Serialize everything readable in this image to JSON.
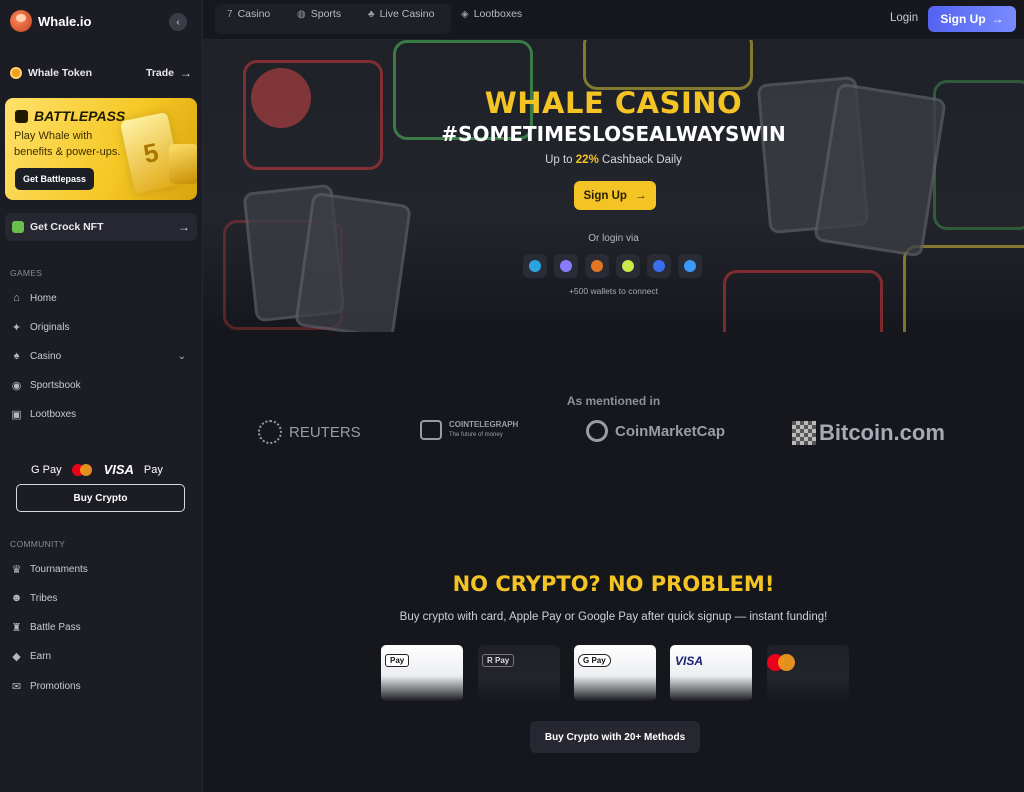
{
  "sidebar": {
    "brand": "Whale.io",
    "collapse_icon": "chevron-left-icon",
    "token": {
      "label": "Whale Token",
      "trade": "Trade"
    },
    "battlepass": {
      "title": "BATTLEPASS",
      "text": "Play Whale with benefits & power-ups.",
      "button": "Get Battlepass",
      "art_number": "5"
    },
    "crock": {
      "label": "Get Crock NFT"
    },
    "games_label": "GAMES",
    "games": [
      {
        "label": "Home",
        "icon": "home-icon"
      },
      {
        "label": "Originals",
        "icon": "originals-icon"
      },
      {
        "label": "Casino",
        "icon": "casino-icon"
      },
      {
        "label": "Sportsbook",
        "icon": "sportsbook-icon"
      },
      {
        "label": "Lootboxes",
        "icon": "lootbox-icon"
      }
    ],
    "payments": {
      "gpay": "G Pay",
      "visa": "VISA",
      "apay": " Pay"
    },
    "buy_crypto": "Buy Crypto",
    "community_label": "COMMUNITY",
    "community": [
      {
        "label": "Tournaments",
        "icon": "trophy-icon"
      },
      {
        "label": "Tribes",
        "icon": "tribes-icon"
      },
      {
        "label": "Battle Pass",
        "icon": "battlepass-icon"
      },
      {
        "label": "Earn",
        "icon": "earn-icon"
      },
      {
        "label": "Promotions",
        "icon": "promotions-icon"
      }
    ]
  },
  "topbar": {
    "nav": [
      {
        "label": "Casino",
        "icon": "seven-icon"
      },
      {
        "label": "Sports",
        "icon": "ball-icon"
      },
      {
        "label": "Live Casino",
        "icon": "cards-icon"
      },
      {
        "label": "Lootboxes",
        "icon": "box-icon"
      }
    ],
    "login": "Login",
    "signup": "Sign Up"
  },
  "hero": {
    "title": "WHALE CASINO",
    "subtitle": "#SOMETIMESLOSEALWAYSWIN",
    "cashback_prefix": "Up to",
    "cashback_value": "22%",
    "cashback_suffix": "Cashback Daily",
    "signup": "Sign Up",
    "or_login": "Or login via",
    "wallet_note": "+500 wallets to connect",
    "wallets": [
      {
        "name": "telegram-icon",
        "color": "#2aa3e0"
      },
      {
        "name": "wallet-icon",
        "color": "#8a7cff"
      },
      {
        "name": "metamask-icon",
        "color": "#e27625"
      },
      {
        "name": "walletconnect-w-icon",
        "color": "#c9e84a"
      },
      {
        "name": "shield-wallet-icon",
        "color": "#3a6df0"
      },
      {
        "name": "wave-icon",
        "color": "#3b99fc"
      }
    ]
  },
  "press": {
    "heading": "As mentioned in",
    "items": [
      {
        "label": "REUTERS"
      },
      {
        "label": "COINTELEGRAPH",
        "sub": "The future of money"
      },
      {
        "label": "CoinMarketCap"
      },
      {
        "label": "Bitcoin.com"
      }
    ]
  },
  "no_crypto": {
    "title": "NO CRYPTO? NO PROBLEM!",
    "subtitle": "Buy crypto with card, Apple Pay or Google Pay after quick signup — instant funding!",
    "methods": [
      {
        "label": " Pay"
      },
      {
        "label": "R Pay"
      },
      {
        "label": "G Pay"
      },
      {
        "label": "VISA"
      },
      {
        "label": "mastercard"
      }
    ],
    "button": "Buy Crypto with 20+ Methods"
  },
  "colors": {
    "accent": "#f4c425",
    "primary": "#5463f0",
    "bg": "#16171d"
  }
}
